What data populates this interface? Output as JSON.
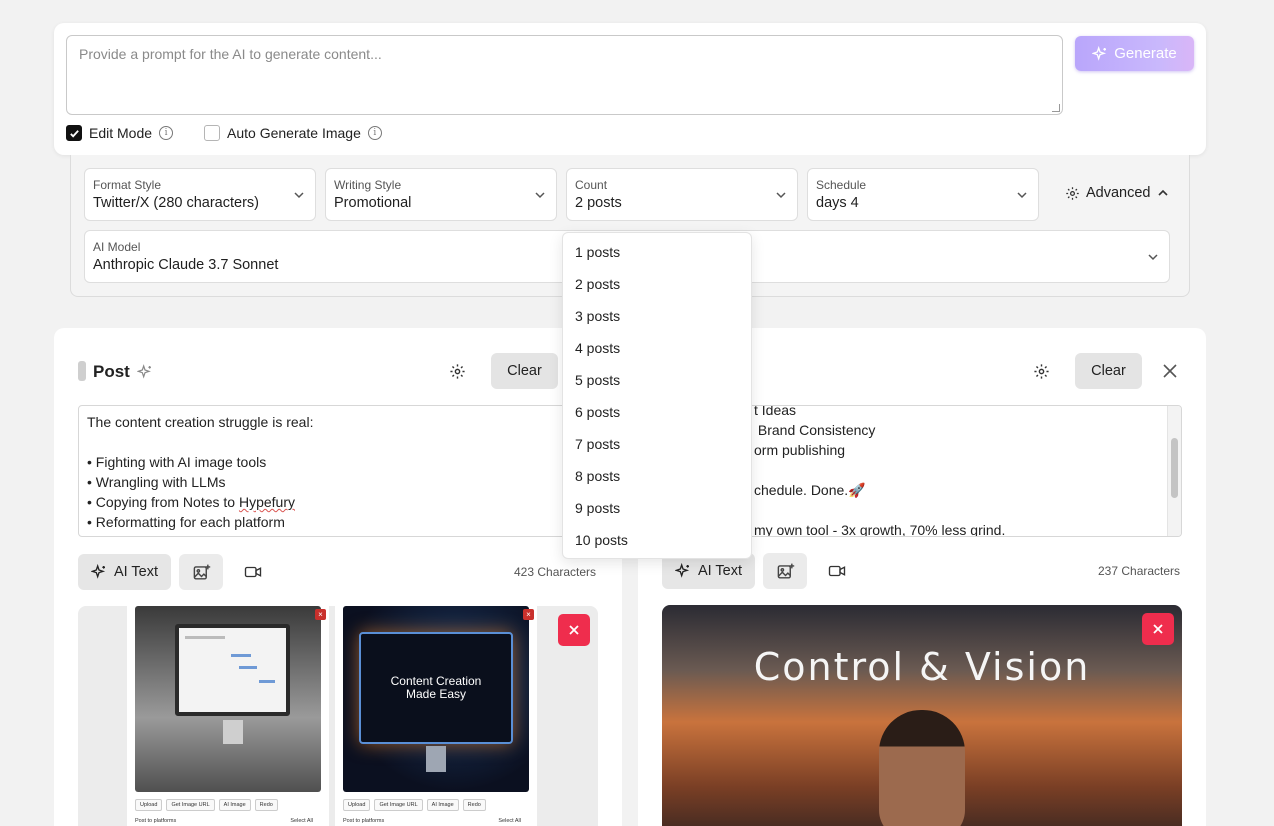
{
  "prompt": {
    "placeholder": "Provide a prompt for the AI to generate content...",
    "generate_label": "Generate",
    "edit_mode_label": "Edit Mode",
    "edit_mode_checked": true,
    "auto_image_label": "Auto Generate Image",
    "auto_image_checked": false
  },
  "settings": {
    "format_style": {
      "label": "Format Style",
      "value": "Twitter/X (280 characters)"
    },
    "writing_style": {
      "label": "Writing Style",
      "value": "Promotional"
    },
    "count": {
      "label": "Count",
      "value": "2 posts"
    },
    "schedule": {
      "label": "Schedule",
      "value": "days 4"
    },
    "advanced_label": "Advanced",
    "ai_model": {
      "label": "AI Model",
      "value": "Anthropic Claude 3.7 Sonnet"
    }
  },
  "count_options": [
    "1 posts",
    "2 posts",
    "3 posts",
    "4 posts",
    "5 posts",
    "6 posts",
    "7 posts",
    "8 posts",
    "9 posts",
    "10 posts"
  ],
  "posts": [
    {
      "title": "Post",
      "clear_label": "Clear",
      "lines": [
        "The content creation struggle is real:",
        "",
        "• Fighting with AI image tools",
        "• Wrangling with LLMs",
        "• Copying from Notes to ",
        "• Reformatting for each platform"
      ],
      "spell_word": "Hypefury",
      "ai_text_label": "AI Text",
      "char_count": "423 Characters",
      "thumbs": [
        {
          "tools": [
            "Upload",
            "Get Image URL",
            "AI Image",
            "Redo"
          ],
          "foot_left": "Post to platforms",
          "foot_right": "Select All"
        },
        {
          "caption_line1": "Content Creation",
          "caption_line2": "Made Easy",
          "tools": [
            "Upload",
            "Get Image URL",
            "AI Image",
            "Redo"
          ],
          "foot_left": "Post to platforms",
          "foot_right": "Select All"
        }
      ]
    },
    {
      "clear_label": "Clear",
      "lines": [
        "t Ideas",
        " Brand Consistency",
        "orm publishing",
        "",
        "chedule. Done.🚀",
        "",
        "my own tool - 3x growth, 70% less grind."
      ],
      "ai_text_label": "AI Text",
      "char_count": "237 Characters",
      "image_title": "Control & Vision"
    }
  ],
  "colors": {
    "accent": "#b9a6fb",
    "danger": "#ef2d4d"
  }
}
